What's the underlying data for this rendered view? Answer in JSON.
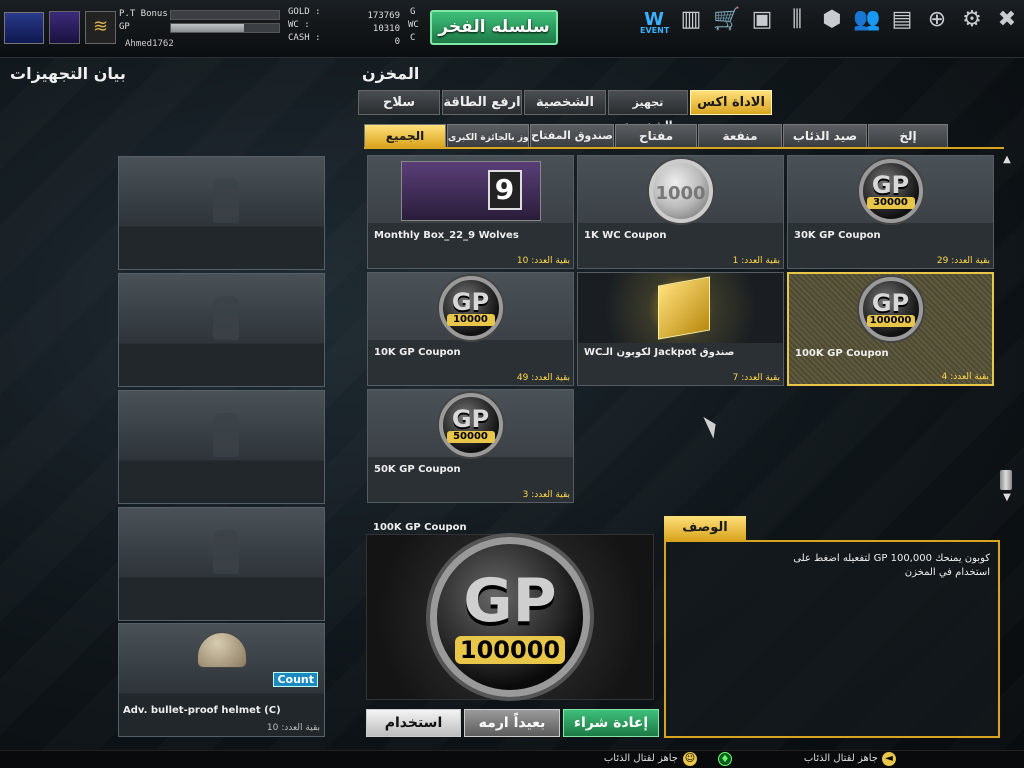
{
  "topbar": {
    "pt_bonus_label": "P.T Bonus",
    "gp_label": "GP",
    "pt_bonus_fill": 0.0,
    "gp_fill": 0.68,
    "username": "Ahmed1762",
    "currency": [
      {
        "label": "GOLD :",
        "value": "173769",
        "unit": "G"
      },
      {
        "label": "WC   :",
        "value": "10310",
        "unit": "WC"
      },
      {
        "label": "CASH :",
        "value": "0",
        "unit": "C"
      }
    ],
    "honor_button": "سلسله الفخر",
    "event_label": "EVENT",
    "icons": [
      "event-icon",
      "ranking-icon",
      "shop-cart-icon",
      "inventory-icon",
      "clan-icon",
      "box-icon",
      "friends-icon",
      "stats-icon",
      "globe-icon",
      "settings-icon",
      "exit-icon"
    ]
  },
  "left_panel": {
    "title": "بيان التجهيزات",
    "slots": [
      {
        "name": "",
        "count": ""
      },
      {
        "name": "",
        "count": ""
      },
      {
        "name": "",
        "count": ""
      },
      {
        "name": "",
        "count": ""
      },
      {
        "name": "Adv. bullet-proof helmet (C)",
        "count": "بقية العدد: 10",
        "badge": "Count"
      }
    ]
  },
  "inventory": {
    "title": "المخزن",
    "tabs": [
      "الاداة اكس",
      "تجهيز الشخصية",
      "الشخصية",
      "ارفع الطاقة",
      "سلاح"
    ],
    "subtabs": [
      "الجميع",
      "الفوز بالجائزة الكبرى",
      "صندوق المفتاح",
      "مفتاح",
      "منفعة",
      "صيد الذئاب",
      "إلخ"
    ],
    "items": [
      {
        "name": "Monthly Box_22_9 Wolves",
        "left": "بقية العدد: 10",
        "art": "9"
      },
      {
        "name": "1K WC Coupon",
        "left": "بقية العدد: 1",
        "art": "1000"
      },
      {
        "name": "30K GP Coupon",
        "left": "بقية العدد: 29",
        "art": "30000"
      },
      {
        "name": "10K GP Coupon",
        "left": "بقية العدد: 49",
        "art": "10000"
      },
      {
        "name": "صندوق Jackpot لكوبون الـWC",
        "left": "بقية العدد: 7",
        "art": ""
      },
      {
        "name": "100K GP Coupon",
        "left": "بقية العدد: 4",
        "art": "100000"
      },
      {
        "name": "50K GP Coupon",
        "left": "بقية العدد: 3",
        "art": "50000"
      }
    ],
    "coin_gp_text": "GP"
  },
  "preview": {
    "name": "100K GP Coupon",
    "gp_text": "GP",
    "amount": "100000"
  },
  "description": {
    "tab": "الوصف",
    "text": "كوبون يمنحك GP 100,000 لتفعيله اضغط على استخدام في المخزن"
  },
  "actions": {
    "use": "استخدام",
    "sell": "بعيداً ارمه",
    "rebuy": "إعادة شراء"
  },
  "statusbar": {
    "status1": "جاهز لقتال الذئاب",
    "status2": "جاهز لقتال الذئاب"
  },
  "colors": {
    "accent": "#e8c64a",
    "honor": "#2aa060"
  }
}
